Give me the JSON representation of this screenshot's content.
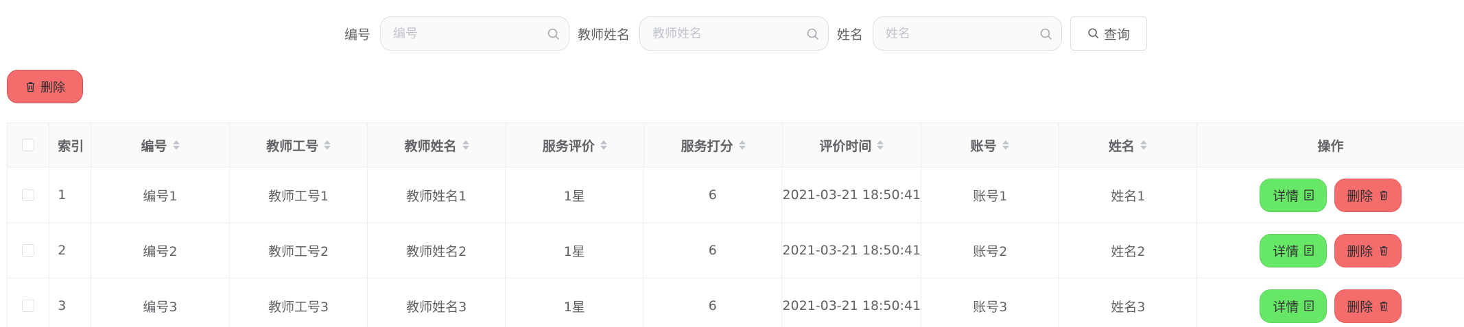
{
  "search": {
    "fields": [
      {
        "label": "编号",
        "placeholder": "编号"
      },
      {
        "label": "教师姓名",
        "placeholder": "教师姓名"
      },
      {
        "label": "姓名",
        "placeholder": "姓名"
      }
    ],
    "query_label": "查询"
  },
  "toolbar": {
    "delete_label": "删除"
  },
  "table": {
    "columns": [
      "索引",
      "编号",
      "教师工号",
      "教师姓名",
      "服务评价",
      "服务打分",
      "评价时间",
      "账号",
      "姓名",
      "操作"
    ],
    "rows": [
      {
        "index": "1",
        "code": "编号1",
        "teacher_no": "教师工号1",
        "teacher_name": "教师姓名1",
        "rating": "1星",
        "score": "6",
        "time": "2021-03-21 18:50:41",
        "account": "账号1",
        "name": "姓名1"
      },
      {
        "index": "2",
        "code": "编号2",
        "teacher_no": "教师工号2",
        "teacher_name": "教师姓名2",
        "rating": "1星",
        "score": "6",
        "time": "2021-03-21 18:50:41",
        "account": "账号2",
        "name": "姓名2"
      },
      {
        "index": "3",
        "code": "编号3",
        "teacher_no": "教师工号3",
        "teacher_name": "教师姓名3",
        "rating": "1星",
        "score": "6",
        "time": "2021-03-21 18:50:41",
        "account": "账号3",
        "name": "姓名3"
      }
    ],
    "actions": {
      "detail": "详情",
      "delete": "删除"
    }
  },
  "colors": {
    "danger": "#f56c6c",
    "success": "#67e766",
    "border": "#ebeef5"
  },
  "icons": {
    "search": "search-icon",
    "delete": "trash-icon",
    "detail": "document-icon"
  }
}
